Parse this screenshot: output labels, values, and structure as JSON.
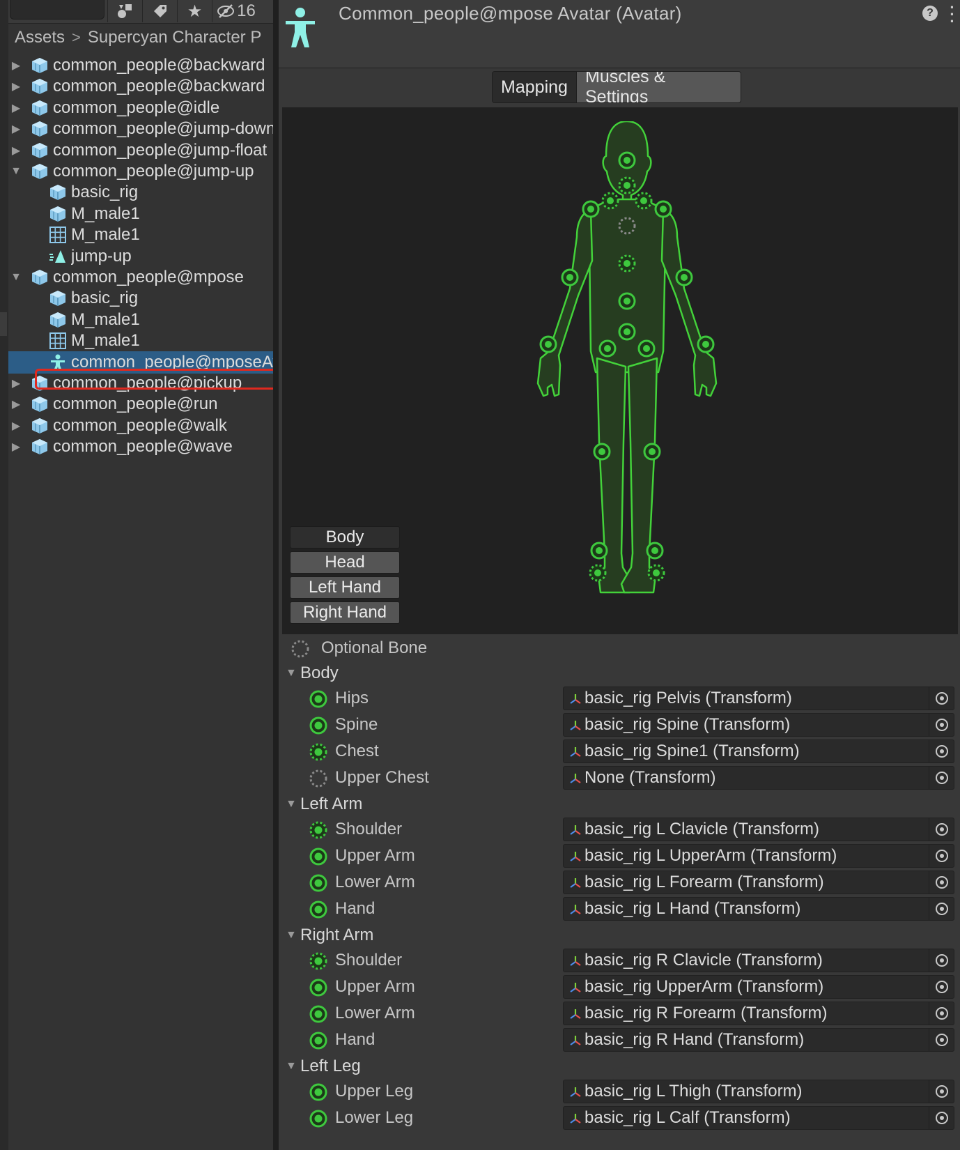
{
  "toolbar": {
    "hidden_count": "16"
  },
  "breadcrumb": {
    "root": "Assets",
    "current": "Supercyan Character P"
  },
  "tree": [
    {
      "label": "common_people@backward",
      "type": "model",
      "depth": 0,
      "fold": "collapsed"
    },
    {
      "label": "common_people@backward",
      "type": "model",
      "depth": 0,
      "fold": "collapsed"
    },
    {
      "label": "common_people@idle",
      "type": "model",
      "depth": 0,
      "fold": "collapsed"
    },
    {
      "label": "common_people@jump-down",
      "type": "model",
      "depth": 0,
      "fold": "collapsed"
    },
    {
      "label": "common_people@jump-float",
      "type": "model",
      "depth": 0,
      "fold": "collapsed"
    },
    {
      "label": "common_people@jump-up",
      "type": "model",
      "depth": 0,
      "fold": "expanded"
    },
    {
      "label": "basic_rig",
      "type": "model",
      "depth": 1,
      "fold": "none"
    },
    {
      "label": "M_male1",
      "type": "model",
      "depth": 1,
      "fold": "none"
    },
    {
      "label": "M_male1",
      "type": "mesh",
      "depth": 1,
      "fold": "none"
    },
    {
      "label": "jump-up",
      "type": "animation",
      "depth": 1,
      "fold": "none"
    },
    {
      "label": "common_people@mpose",
      "type": "model",
      "depth": 0,
      "fold": "expanded"
    },
    {
      "label": "basic_rig",
      "type": "model",
      "depth": 1,
      "fold": "none"
    },
    {
      "label": "M_male1",
      "type": "model",
      "depth": 1,
      "fold": "none"
    },
    {
      "label": "M_male1",
      "type": "mesh",
      "depth": 1,
      "fold": "none"
    },
    {
      "label": "common_people@mposeAvatar",
      "type": "avatar",
      "depth": 1,
      "fold": "none",
      "selected": true
    },
    {
      "label": "common_people@pickup",
      "type": "model",
      "depth": 0,
      "fold": "collapsed"
    },
    {
      "label": "common_people@run",
      "type": "model",
      "depth": 0,
      "fold": "collapsed"
    },
    {
      "label": "common_people@walk",
      "type": "model",
      "depth": 0,
      "fold": "collapsed"
    },
    {
      "label": "common_people@wave",
      "type": "model",
      "depth": 0,
      "fold": "collapsed"
    }
  ],
  "inspector": {
    "title": "Common_people@mpose Avatar (Avatar)",
    "tabs": [
      {
        "label": "Mapping",
        "active": true
      },
      {
        "label": "Muscles & Settings",
        "active": false
      }
    ],
    "view_buttons": [
      {
        "label": "Body",
        "active": true
      },
      {
        "label": "Head",
        "active": false
      },
      {
        "label": "Left Hand",
        "active": false
      },
      {
        "label": "Right Hand",
        "active": false
      }
    ],
    "legend": "Optional Bone",
    "sections": [
      {
        "label": "Body",
        "bones": [
          {
            "label": "Hips",
            "value": "basic_rig Pelvis (Transform)",
            "kind": "required"
          },
          {
            "label": "Spine",
            "value": "basic_rig Spine (Transform)",
            "kind": "required"
          },
          {
            "label": "Chest",
            "value": "basic_rig Spine1 (Transform)",
            "kind": "optional-mapped"
          },
          {
            "label": "Upper Chest",
            "value": "None (Transform)",
            "kind": "optional-empty"
          }
        ]
      },
      {
        "label": "Left Arm",
        "bones": [
          {
            "label": "Shoulder",
            "value": "basic_rig L Clavicle (Transform)",
            "kind": "optional-mapped"
          },
          {
            "label": "Upper Arm",
            "value": "basic_rig L UpperArm (Transform)",
            "kind": "required"
          },
          {
            "label": "Lower Arm",
            "value": "basic_rig L Forearm (Transform)",
            "kind": "required"
          },
          {
            "label": "Hand",
            "value": "basic_rig L Hand (Transform)",
            "kind": "required"
          }
        ]
      },
      {
        "label": "Right Arm",
        "bones": [
          {
            "label": "Shoulder",
            "value": "basic_rig R Clavicle (Transform)",
            "kind": "optional-mapped"
          },
          {
            "label": "Upper Arm",
            "value": "basic_rig UpperArm (Transform)",
            "kind": "required"
          },
          {
            "label": "Lower Arm",
            "value": "basic_rig R Forearm (Transform)",
            "kind": "required"
          },
          {
            "label": "Hand",
            "value": "basic_rig R Hand (Transform)",
            "kind": "required"
          }
        ]
      },
      {
        "label": "Left Leg",
        "bones": [
          {
            "label": "Upper Leg",
            "value": "basic_rig L Thigh (Transform)",
            "kind": "required"
          },
          {
            "label": "Lower Leg",
            "value": "basic_rig L Calf (Transform)",
            "kind": "required"
          }
        ]
      }
    ]
  },
  "colors": {
    "bone_green": "#3ec83e",
    "selection_blue": "#2c5d87",
    "highlight_red": "#e0291f",
    "avatar_cyan": "#8ff0e6"
  }
}
